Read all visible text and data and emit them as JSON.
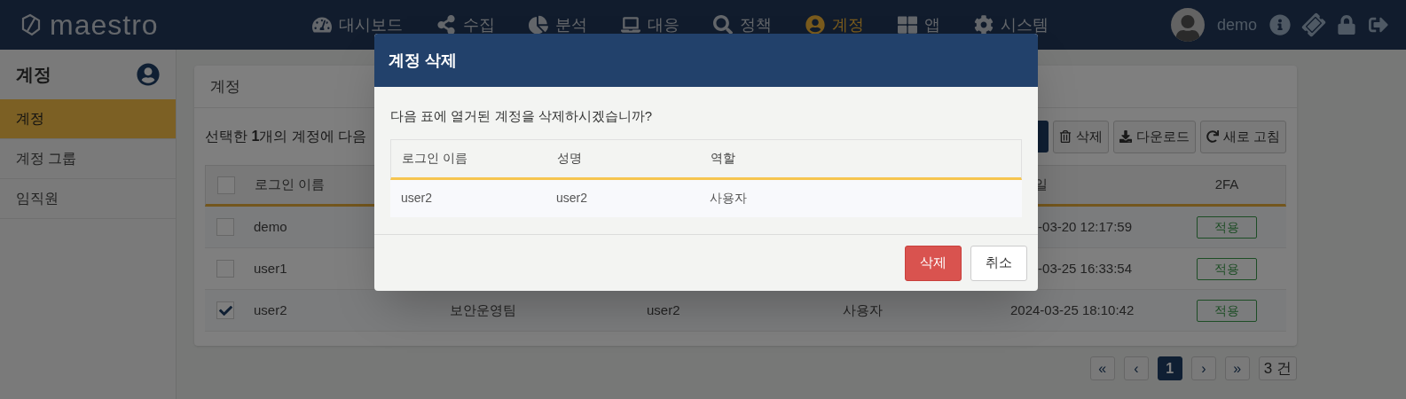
{
  "app": {
    "logo": "maestro"
  },
  "nav": [
    {
      "label": "대시보드",
      "selected": false
    },
    {
      "label": "수집",
      "selected": false
    },
    {
      "label": "분석",
      "selected": false
    },
    {
      "label": "대응",
      "selected": false
    },
    {
      "label": "정책",
      "selected": false
    },
    {
      "label": "계정",
      "selected": true
    },
    {
      "label": "앱",
      "selected": false
    },
    {
      "label": "시스템",
      "selected": false
    }
  ],
  "user": {
    "name": "demo"
  },
  "sidebar": {
    "title": "계정",
    "items": [
      {
        "label": "계정",
        "selected": true
      },
      {
        "label": "계정 그룹",
        "selected": false
      },
      {
        "label": "임직원",
        "selected": false
      }
    ]
  },
  "panel": {
    "title": "계정",
    "selection_note": "선택한 **1**개의 계정에 다음",
    "toolbar": [
      "삭제",
      "다운로드",
      "새로 고침"
    ],
    "table": {
      "select_all": {
        "checked": false
      },
      "columns": {
        "login": "로그인 이름",
        "date": "일",
        "twofa": "2FA"
      },
      "rows": [
        {
          "checked": false,
          "login": "demo",
          "date": "-03-20 12:17:59",
          "twofa": "적용"
        },
        {
          "checked": false,
          "login": "user1",
          "date": "-03-25 16:33:54",
          "twofa": "적용"
        },
        {
          "checked": true,
          "login": "user2",
          "group": "보안운영팀",
          "name": "user2",
          "role": "사용자",
          "date": "2024-03-25 18:10:42",
          "twofa": "적용"
        }
      ]
    }
  },
  "pagination": {
    "pages": [
      {
        "label": "«",
        "selected": false
      },
      {
        "label": "‹",
        "selected": false
      },
      {
        "label": "1",
        "selected": true
      },
      {
        "label": "›",
        "selected": false
      },
      {
        "label": "»",
        "selected": false
      }
    ],
    "count": "3 건"
  },
  "dialog": {
    "title": "계정 삭제",
    "message": "다음 표에 열거된 계정을 삭제하시겠습니까?",
    "table": {
      "columns": [
        "로그인 이름",
        "성명",
        "역할"
      ],
      "rows": [
        [
          "user2",
          "user2",
          "사용자"
        ]
      ]
    },
    "buttons": [
      {
        "label": "삭제",
        "kind": "danger"
      },
      {
        "label": "취소",
        "kind": "default"
      }
    ]
  }
}
